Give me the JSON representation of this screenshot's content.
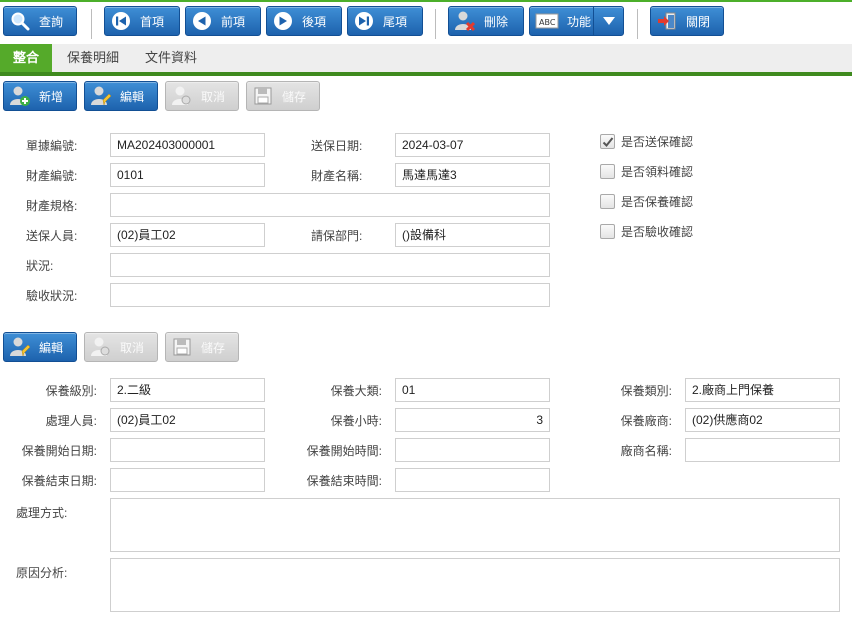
{
  "toolbar": {
    "query": "查詢",
    "first": "首項",
    "prev": "前項",
    "next": "後項",
    "last": "尾項",
    "delete": "刪除",
    "function": "功能",
    "function_icon_text": "ABC",
    "close": "關閉"
  },
  "tabs": [
    {
      "label": "整合",
      "active": true
    },
    {
      "label": "保養明細",
      "active": false
    },
    {
      "label": "文件資料",
      "active": false
    }
  ],
  "edit_bar1": {
    "add": "新增",
    "edit": "編輯",
    "cancel": "取消",
    "save": "儲存"
  },
  "edit_bar2": {
    "edit": "編輯",
    "cancel": "取消",
    "save": "儲存"
  },
  "form": {
    "doc_no_label": "單據編號:",
    "doc_no": "MA202403000001",
    "send_date_label": "送保日期:",
    "send_date": "2024-03-07",
    "asset_no_label": "財產編號:",
    "asset_no": "0101",
    "asset_name_label": "財產名稱:",
    "asset_name": "馬達馬達3",
    "asset_spec_label": "財產規格:",
    "asset_spec": "",
    "sender_label": "送保人員:",
    "sender": "(02)員工02",
    "request_dept_label": "請保部門:",
    "request_dept": "()設備科",
    "status_label": "狀況:",
    "status": "",
    "accept_status_label": "驗收狀況:",
    "accept_status": ""
  },
  "checks": [
    {
      "label": "是否送保確認",
      "checked": true
    },
    {
      "label": "是否領料確認",
      "checked": false
    },
    {
      "label": "是否保養確認",
      "checked": false
    },
    {
      "label": "是否驗收確認",
      "checked": false
    }
  ],
  "maint": {
    "level_label": "保養級別:",
    "level": "2.二級",
    "major_label": "保養大類:",
    "major": "01",
    "type_label": "保養類別:",
    "type": "2.廠商上門保養",
    "handler_label": "處理人員:",
    "handler": "(02)員工02",
    "hours_label": "保養小時:",
    "hours": "3",
    "vendor_label": "保養廠商:",
    "vendor": "(02)供應商02",
    "start_date_label": "保養開始日期:",
    "start_date": "",
    "start_time_label": "保養開始時間:",
    "start_time": "",
    "vendor_name_label": "廠商名稱:",
    "vendor_name": "",
    "end_date_label": "保養結束日期:",
    "end_date": "",
    "end_time_label": "保養結束時間:",
    "end_time": "",
    "method_label": "處理方式:",
    "method": "",
    "cause_label": "原因分析:",
    "cause": ""
  },
  "colors": {
    "accent_green": "#55aa2a",
    "button_blue": "#1d62ad"
  }
}
